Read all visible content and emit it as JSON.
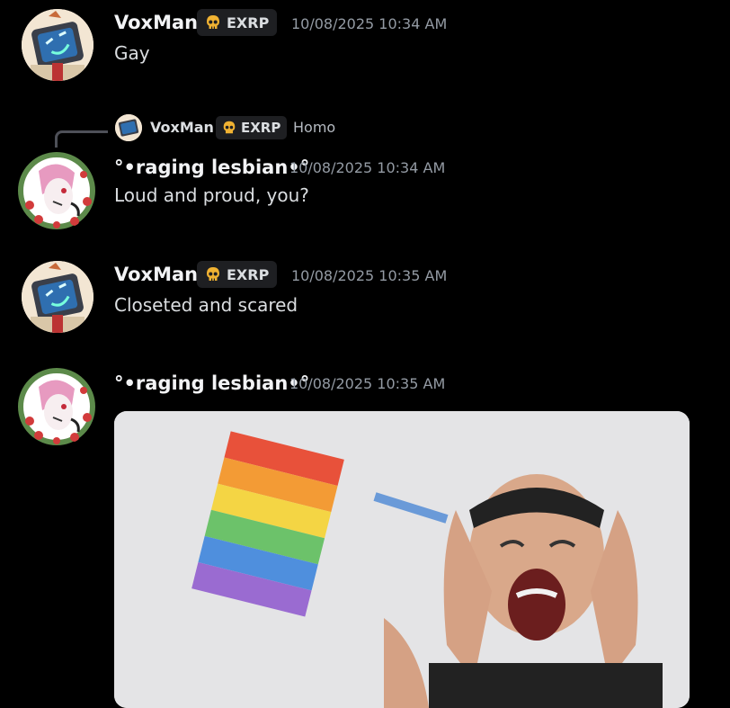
{
  "messages": [
    {
      "author": "VoxMan",
      "tag": "EXRP",
      "timestamp": "10/08/2025 10:34 AM",
      "text": "Gay"
    },
    {
      "reply": {
        "author": "VoxMan",
        "tag": "EXRP",
        "text": "Homo"
      },
      "author": "°•raging lesbian•°",
      "timestamp": "10/08/2025 10:34 AM",
      "text": "Loud and proud, you?"
    },
    {
      "author": "VoxMan",
      "tag": "EXRP",
      "timestamp": "10/08/2025 10:35 AM",
      "text": "Closeted and scared"
    },
    {
      "author": "°•raging lesbian•°",
      "timestamp": "10/08/2025 10:35 AM",
      "attachment": "gif-image"
    }
  ],
  "icons": {
    "tag_icon": "skull-icon",
    "voxman_avatar": "tv-head-avatar",
    "lesbian_avatar": "flower-wreath-avatar"
  },
  "colors": {
    "background": "#000000",
    "username": "#f2f3f5",
    "timestamp": "#949ba4",
    "tag_bg": "#1e1f22",
    "skull": "#f0b232"
  }
}
